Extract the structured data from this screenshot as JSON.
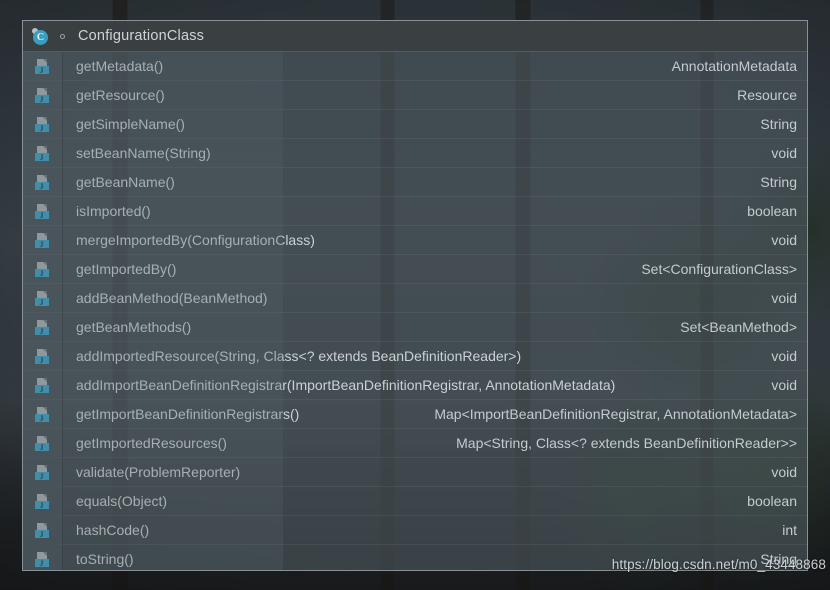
{
  "panel": {
    "title": "ConfigurationClass",
    "class_icon": "class-icon",
    "class_icon_letter": "C",
    "marker_icon": "dot-marker-icon",
    "method_icon": "java-method-icon",
    "method_icon_letter": "J",
    "accent_blue": "#3aa3c7",
    "header_bg": "#3a3e42",
    "text_color": "#ccd1d5",
    "border_color": "#8a9196"
  },
  "members": [
    {
      "name": "getMetadata()",
      "type": "AnnotationMetadata"
    },
    {
      "name": "getResource()",
      "type": "Resource"
    },
    {
      "name": "getSimpleName()",
      "type": "String"
    },
    {
      "name": "setBeanName(String)",
      "type": "void"
    },
    {
      "name": "getBeanName()",
      "type": "String"
    },
    {
      "name": "isImported()",
      "type": "boolean"
    },
    {
      "name": "mergeImportedBy(ConfigurationClass)",
      "type": "void"
    },
    {
      "name": "getImportedBy()",
      "type": "Set<ConfigurationClass>"
    },
    {
      "name": "addBeanMethod(BeanMethod)",
      "type": "void"
    },
    {
      "name": "getBeanMethods()",
      "type": "Set<BeanMethod>"
    },
    {
      "name": "addImportedResource(String, Class<? extends BeanDefinitionReader>)",
      "type": "void"
    },
    {
      "name": "addImportBeanDefinitionRegistrar(ImportBeanDefinitionRegistrar, AnnotationMetadata)",
      "type": "void"
    },
    {
      "name": "getImportBeanDefinitionRegistrars()",
      "type": "Map<ImportBeanDefinitionRegistrar, AnnotationMetadata>"
    },
    {
      "name": "getImportedResources()",
      "type": "Map<String, Class<? extends BeanDefinitionReader>>"
    },
    {
      "name": "validate(ProblemReporter)",
      "type": "void"
    },
    {
      "name": "equals(Object)",
      "type": "boolean"
    },
    {
      "name": "hashCode()",
      "type": "int"
    },
    {
      "name": "toString()",
      "type": "String"
    }
  ],
  "watermark": "https://blog.csdn.net/m0_43448868"
}
